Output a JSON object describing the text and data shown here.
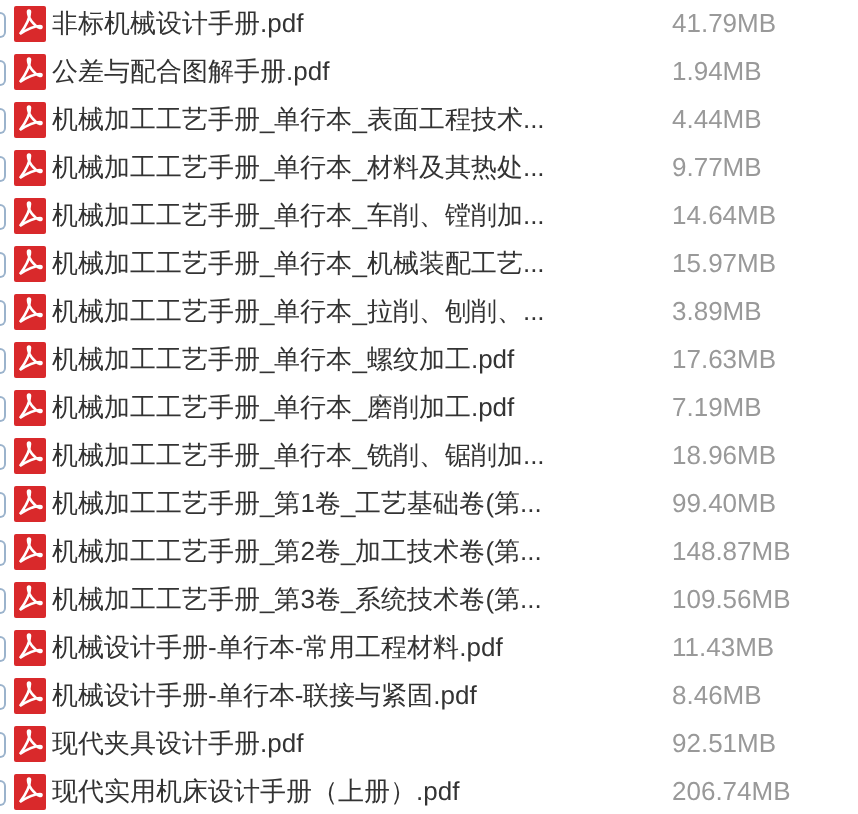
{
  "files": [
    {
      "name": "非标机械设计手册.pdf",
      "size": "41.79MB",
      "checked": false
    },
    {
      "name": "公差与配合图解手册.pdf",
      "size": "1.94MB",
      "checked": false
    },
    {
      "name": "机械加工工艺手册_单行本_表面工程技术...",
      "size": "4.44MB",
      "checked": false
    },
    {
      "name": "机械加工工艺手册_单行本_材料及其热处...",
      "size": "9.77MB",
      "checked": false
    },
    {
      "name": "机械加工工艺手册_单行本_车削、镗削加...",
      "size": "14.64MB",
      "checked": false
    },
    {
      "name": "机械加工工艺手册_单行本_机械装配工艺...",
      "size": "15.97MB",
      "checked": false
    },
    {
      "name": "机械加工工艺手册_单行本_拉削、刨削、...",
      "size": "3.89MB",
      "checked": false
    },
    {
      "name": "机械加工工艺手册_单行本_螺纹加工.pdf",
      "size": "17.63MB",
      "checked": false
    },
    {
      "name": "机械加工工艺手册_单行本_磨削加工.pdf",
      "size": "7.19MB",
      "checked": false
    },
    {
      "name": "机械加工工艺手册_单行本_铣削、锯削加...",
      "size": "18.96MB",
      "checked": false
    },
    {
      "name": "机械加工工艺手册_第1卷_工艺基础卷(第...",
      "size": "99.40MB",
      "checked": false
    },
    {
      "name": "机械加工工艺手册_第2卷_加工技术卷(第...",
      "size": "148.87MB",
      "checked": false
    },
    {
      "name": "机械加工工艺手册_第3卷_系统技术卷(第...",
      "size": "109.56MB",
      "checked": false
    },
    {
      "name": "机械设计手册-单行本-常用工程材料.pdf",
      "size": "11.43MB",
      "checked": false
    },
    {
      "name": "机械设计手册-单行本-联接与紧固.pdf",
      "size": "8.46MB",
      "checked": false
    },
    {
      "name": "现代夹具设计手册.pdf",
      "size": "92.51MB",
      "checked": false
    },
    {
      "name": "现代实用机床设计手册（上册）.pdf",
      "size": "206.74MB",
      "checked": false
    }
  ]
}
